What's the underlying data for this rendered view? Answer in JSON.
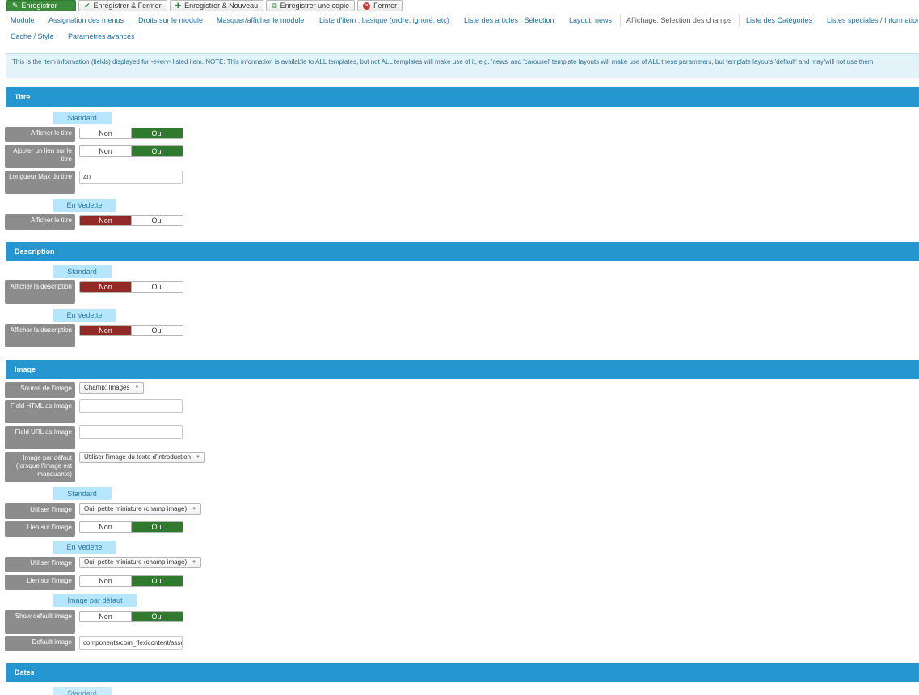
{
  "toolbar": {
    "save": "Enregistrer",
    "save_close": "Enregistrer & Fermer",
    "save_new": "Enregistrer & Nouveau",
    "save_copy": "Enregistrer une copie",
    "close": "Fermer"
  },
  "tabs": [
    "Module",
    "Assignation des menus",
    "Droits sur le module",
    "Masquer/afficher le module",
    "Liste d'item : basique (ordre, ignoré, etc)",
    "Liste des articles : Sélection",
    "Layout: news",
    "Affichage: Sélection des champs",
    "Liste des Catégories",
    "Listes spéciales / Informations",
    "Cache / Style",
    "Paramètres avancés"
  ],
  "info": "This is the item information (fields) displayed for -every- listed item. NOTE: This information is available to ALL templates, but not ALL templates will make use of it, e.g. 'news' and 'carousel' template layouts will make use of ALL these parameters, but template layouts 'default' and may/will not use them",
  "toggle": {
    "no": "Non",
    "yes": "Oui"
  },
  "titre": {
    "header": "Titre",
    "standard": "Standard",
    "show_title": "Afficher le titre",
    "link_title": "Ajouter un lien sur le titre",
    "max_len_label": "Longueur Max du titre",
    "max_len_value": "40",
    "featured": "En Vedette",
    "show_title_feat": "Afficher le titre"
  },
  "description": {
    "header": "Description",
    "standard": "Standard",
    "show_desc": "Afficher la description",
    "featured": "En Vedette",
    "show_desc_feat": "Afficher la description"
  },
  "image": {
    "header": "Image",
    "source_label": "Source de l'image",
    "source_value": "Champ: Images",
    "html_label": "Field HTML as Image",
    "url_label": "Field URL as Image",
    "default_label": "Image par défaut (lorsque l'image est manquante)",
    "default_value": "Utiliser l'image du texte d'introduction",
    "standard": "Standard",
    "use_label": "Utiliser l'image",
    "use_value": "Oui, petite miniature (champ image)",
    "link_label": "Lien sur l'image",
    "featured": "En Vedette",
    "use_label_feat": "Utiliser l'image",
    "use_value_feat": "Oui, petite miniature (champ image)",
    "link_label_feat": "Lien sur l'image",
    "default_sub": "Image par défaut",
    "show_default_label": "Show default image",
    "default_image_label": "Default image",
    "default_image_value": "components/com_flexicontent/assets/images/image.png"
  },
  "dates": {
    "header": "Dates",
    "standard": "Standard"
  }
}
